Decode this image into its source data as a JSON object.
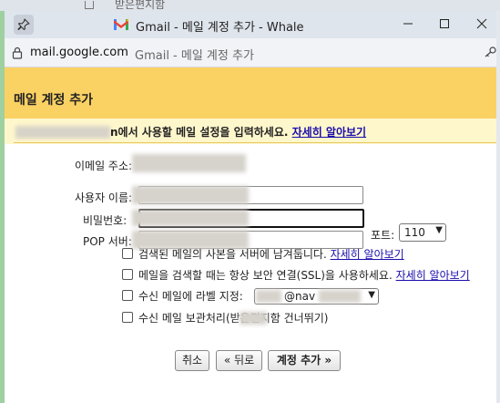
{
  "background_window": {
    "partial_text": "받은편지함"
  },
  "window": {
    "title": "Gmail - 메일 계정 추가 - Whale",
    "controls": {
      "minimize": "minimize",
      "maximize": "maximize",
      "close": "close"
    }
  },
  "addressbar": {
    "host": "mail.google.com",
    "page_title": "Gmail - 메일 계정 추가"
  },
  "popup": {
    "title": "메일 계정 추가",
    "instruction": "n에서 사용할 메일 설정을 입력하세요.",
    "instruction_link": "자세히 알아보기"
  },
  "form": {
    "email_label": "이메일 주소:",
    "username_label": "사용자 이름:",
    "password_label": "비밀번호:",
    "pop_server_label": "POP 서버:",
    "port_label": "포트:",
    "port_value": "110",
    "options": [
      {
        "text": "검색된 메일의 사본을 서버에 남겨둡니다.",
        "link": "자세히 알아보기",
        "checked": false
      },
      {
        "text": "메일을 검색할 때는 항상 보안 연결(SSL)을 사용하세요.",
        "link": "자세히 알아보기",
        "checked": false
      },
      {
        "text": "수신 메일에 라벨 지정:",
        "link": "",
        "checked": false
      },
      {
        "text": "수신 메일 보관처리(받은편지함 건너뛰기)",
        "link": "",
        "checked": false
      }
    ],
    "label_select_value": "@nav"
  },
  "buttons": {
    "cancel": "취소",
    "back": "« 뒤로",
    "add_account": "계정 추가 »"
  },
  "colors": {
    "header_bg": "#fad163",
    "instruction_bg": "#fff7cc",
    "link": "#1a0dab"
  }
}
